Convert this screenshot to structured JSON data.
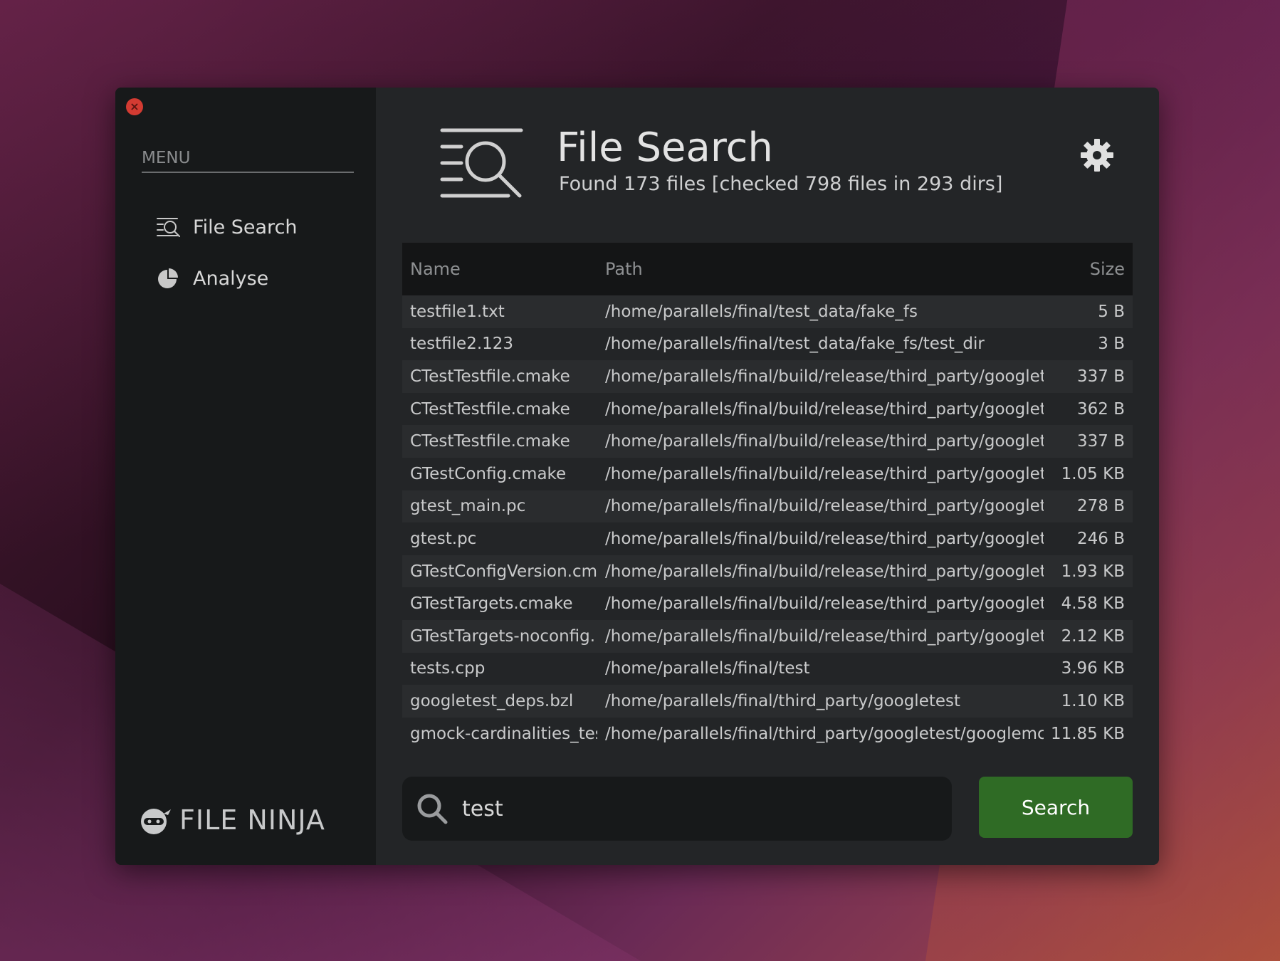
{
  "window": {
    "close_label": "×"
  },
  "sidebar": {
    "menu_label": "MENU",
    "items": [
      {
        "label": "File Search",
        "icon": "file-search-icon"
      },
      {
        "label": "Analyse",
        "icon": "pie-chart-icon"
      }
    ],
    "logo_text": "FILE NINJA"
  },
  "header": {
    "title": "File Search",
    "subtitle": "Found 173 files [checked 798 files in 293 dirs]"
  },
  "table": {
    "columns": {
      "name": "Name",
      "path": "Path",
      "size": "Size"
    },
    "rows": [
      {
        "name": "testfile1.txt",
        "path": "/home/parallels/final/test_data/fake_fs",
        "size": "5 B"
      },
      {
        "name": "testfile2.123",
        "path": "/home/parallels/final/test_data/fake_fs/test_dir",
        "size": "3 B"
      },
      {
        "name": "CTestTestfile.cmake",
        "path": "/home/parallels/final/build/release/third_party/googlet",
        "size": "337 B"
      },
      {
        "name": "CTestTestfile.cmake",
        "path": "/home/parallels/final/build/release/third_party/googlet",
        "size": "362 B"
      },
      {
        "name": "CTestTestfile.cmake",
        "path": "/home/parallels/final/build/release/third_party/googlet",
        "size": "337 B"
      },
      {
        "name": "GTestConfig.cmake",
        "path": "/home/parallels/final/build/release/third_party/googlet",
        "size": "1.05 KB"
      },
      {
        "name": "gtest_main.pc",
        "path": "/home/parallels/final/build/release/third_party/googlet",
        "size": "278 B"
      },
      {
        "name": "gtest.pc",
        "path": "/home/parallels/final/build/release/third_party/googlet",
        "size": "246 B"
      },
      {
        "name": "GTestConfigVersion.cm",
        "path": "/home/parallels/final/build/release/third_party/googlet",
        "size": "1.93 KB"
      },
      {
        "name": "GTestTargets.cmake",
        "path": "/home/parallels/final/build/release/third_party/googlet",
        "size": "4.58 KB"
      },
      {
        "name": "GTestTargets-noconfig.",
        "path": "/home/parallels/final/build/release/third_party/googlet",
        "size": "2.12 KB"
      },
      {
        "name": "tests.cpp",
        "path": "/home/parallels/final/test",
        "size": "3.96 KB"
      },
      {
        "name": "googletest_deps.bzl",
        "path": "/home/parallels/final/third_party/googletest",
        "size": "1.10 KB"
      },
      {
        "name": "gmock-cardinalities_tes",
        "path": "/home/parallels/final/third_party/googletest/googlemc",
        "size": "11.85 KB"
      }
    ]
  },
  "search": {
    "value": "test",
    "button_label": "Search"
  },
  "colors": {
    "accent": "#2f6b25",
    "close": "#d33b32",
    "sidebar": "#17191a",
    "panel": "#232527"
  }
}
